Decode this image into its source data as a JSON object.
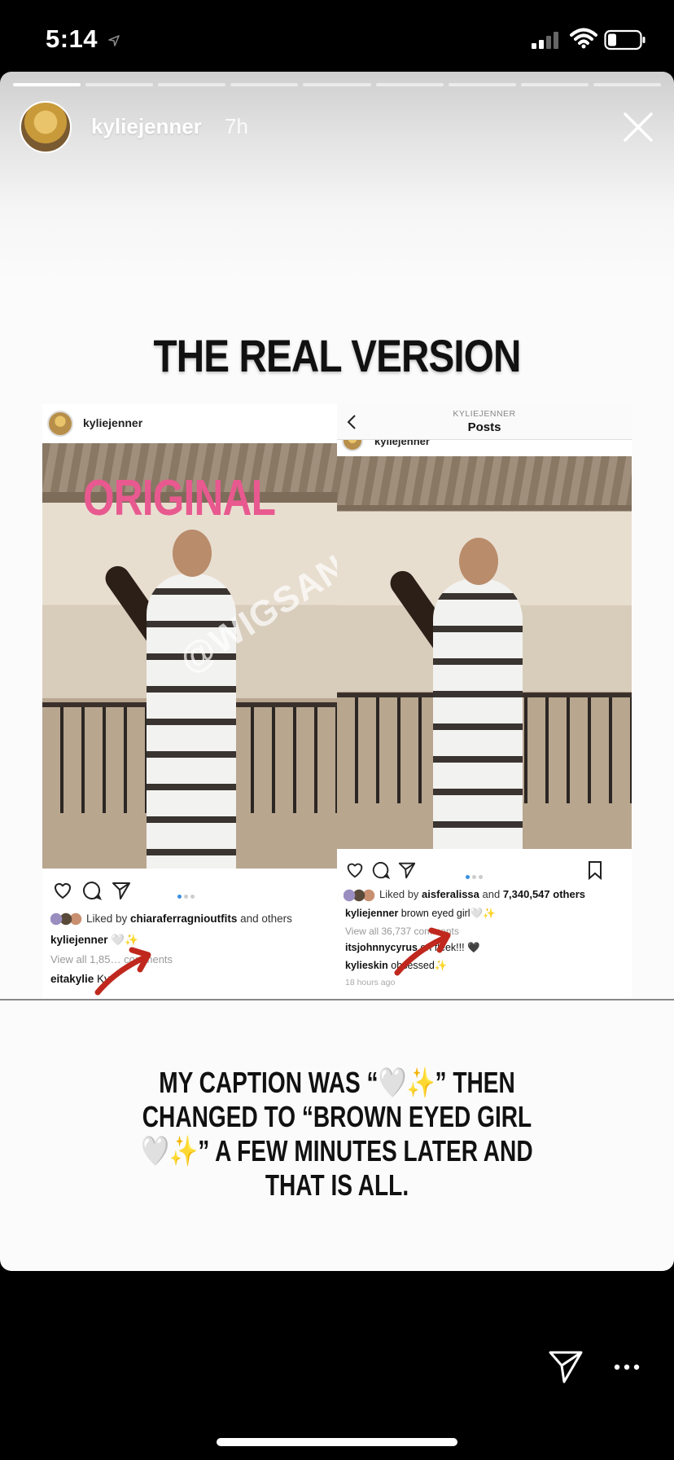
{
  "status_bar": {
    "time": "5:14"
  },
  "story": {
    "progress_segments": 9,
    "progress_done": 1,
    "username": "kyliejenner",
    "time_ago": "7h",
    "headline": "THE REAL VERSION",
    "caption_note": "MY CAPTION WAS “🤍✨” THEN CHANGED TO “BROWN EYED GIRL🤍✨” A FEW MINUTES LATER AND THAT IS ALL."
  },
  "left_post": {
    "username": "kyliejenner",
    "overlay_label": "ORIGINAL",
    "watermark": "@WIGSANDTEA",
    "liked_prefix": "Liked by ",
    "liked_user": "chiaraferragnioutfits",
    "liked_suffix": " and others",
    "caption_user": "kyliejenner",
    "caption_text": " 🤍✨",
    "view_comments": "View all 1,85… comments",
    "comment_user": "eitakylie",
    "comment_text": " Ky"
  },
  "right_post": {
    "nav_subtitle": "KYLIEJENNER",
    "nav_title": "Posts",
    "username_cut": "kyliejenner",
    "liked_prefix": "Liked by ",
    "liked_user": "aisferalissa",
    "liked_mid": " and ",
    "liked_count": "7,340,547 others",
    "caption_user": "kyliejenner",
    "caption_text": " brown eyed girl🤍✨",
    "view_comments": "View all 36,737 comments",
    "comment1_user": "itsjohnnycyrus",
    "comment1_text": " on fleek!!! 🖤",
    "comment2_user": "kylieskin",
    "comment2_text": " obsessed✨",
    "time": "18 hours ago"
  },
  "colors": {
    "accent_pink": "#e8598f",
    "arrow_red": "#c0281e",
    "dot_blue": "#3a90e0"
  }
}
